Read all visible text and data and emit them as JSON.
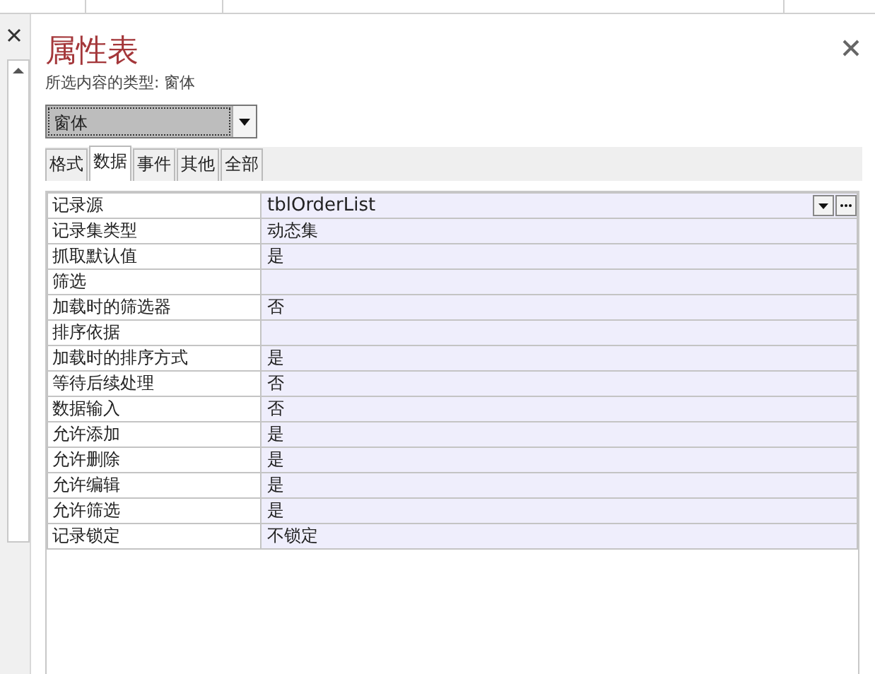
{
  "panel": {
    "title": "属性表",
    "subtitle": "所选内容的类型: 窗体",
    "object_selector": {
      "value": "窗体"
    }
  },
  "tabs": [
    {
      "label": "格式",
      "selected": false
    },
    {
      "label": "数据",
      "selected": true
    },
    {
      "label": "事件",
      "selected": false
    },
    {
      "label": "其他",
      "selected": false
    },
    {
      "label": "全部",
      "selected": false
    }
  ],
  "properties": [
    {
      "name": "记录源",
      "value": "tblOrderList",
      "selected": true
    },
    {
      "name": "记录集类型",
      "value": "动态集",
      "selected": false
    },
    {
      "name": "抓取默认值",
      "value": "是",
      "selected": false
    },
    {
      "name": "筛选",
      "selected": false
    },
    {
      "name": "加载时的筛选器",
      "value": "否",
      "selected": false
    },
    {
      "name": "排序依据",
      "selected": false
    },
    {
      "name": "加载时的排序方式",
      "value": "是",
      "selected": false
    },
    {
      "name": "等待后续处理",
      "value": "否",
      "selected": false
    },
    {
      "name": "数据输入",
      "value": "否",
      "selected": false
    },
    {
      "name": "允许添加",
      "value": "是",
      "selected": false
    },
    {
      "name": "允许删除",
      "value": "是",
      "selected": false
    },
    {
      "name": "允许编辑",
      "value": "是",
      "selected": false
    },
    {
      "name": "允许筛选",
      "value": "是",
      "selected": false
    },
    {
      "name": "记录锁定",
      "value": "不锁定",
      "selected": false
    }
  ]
}
